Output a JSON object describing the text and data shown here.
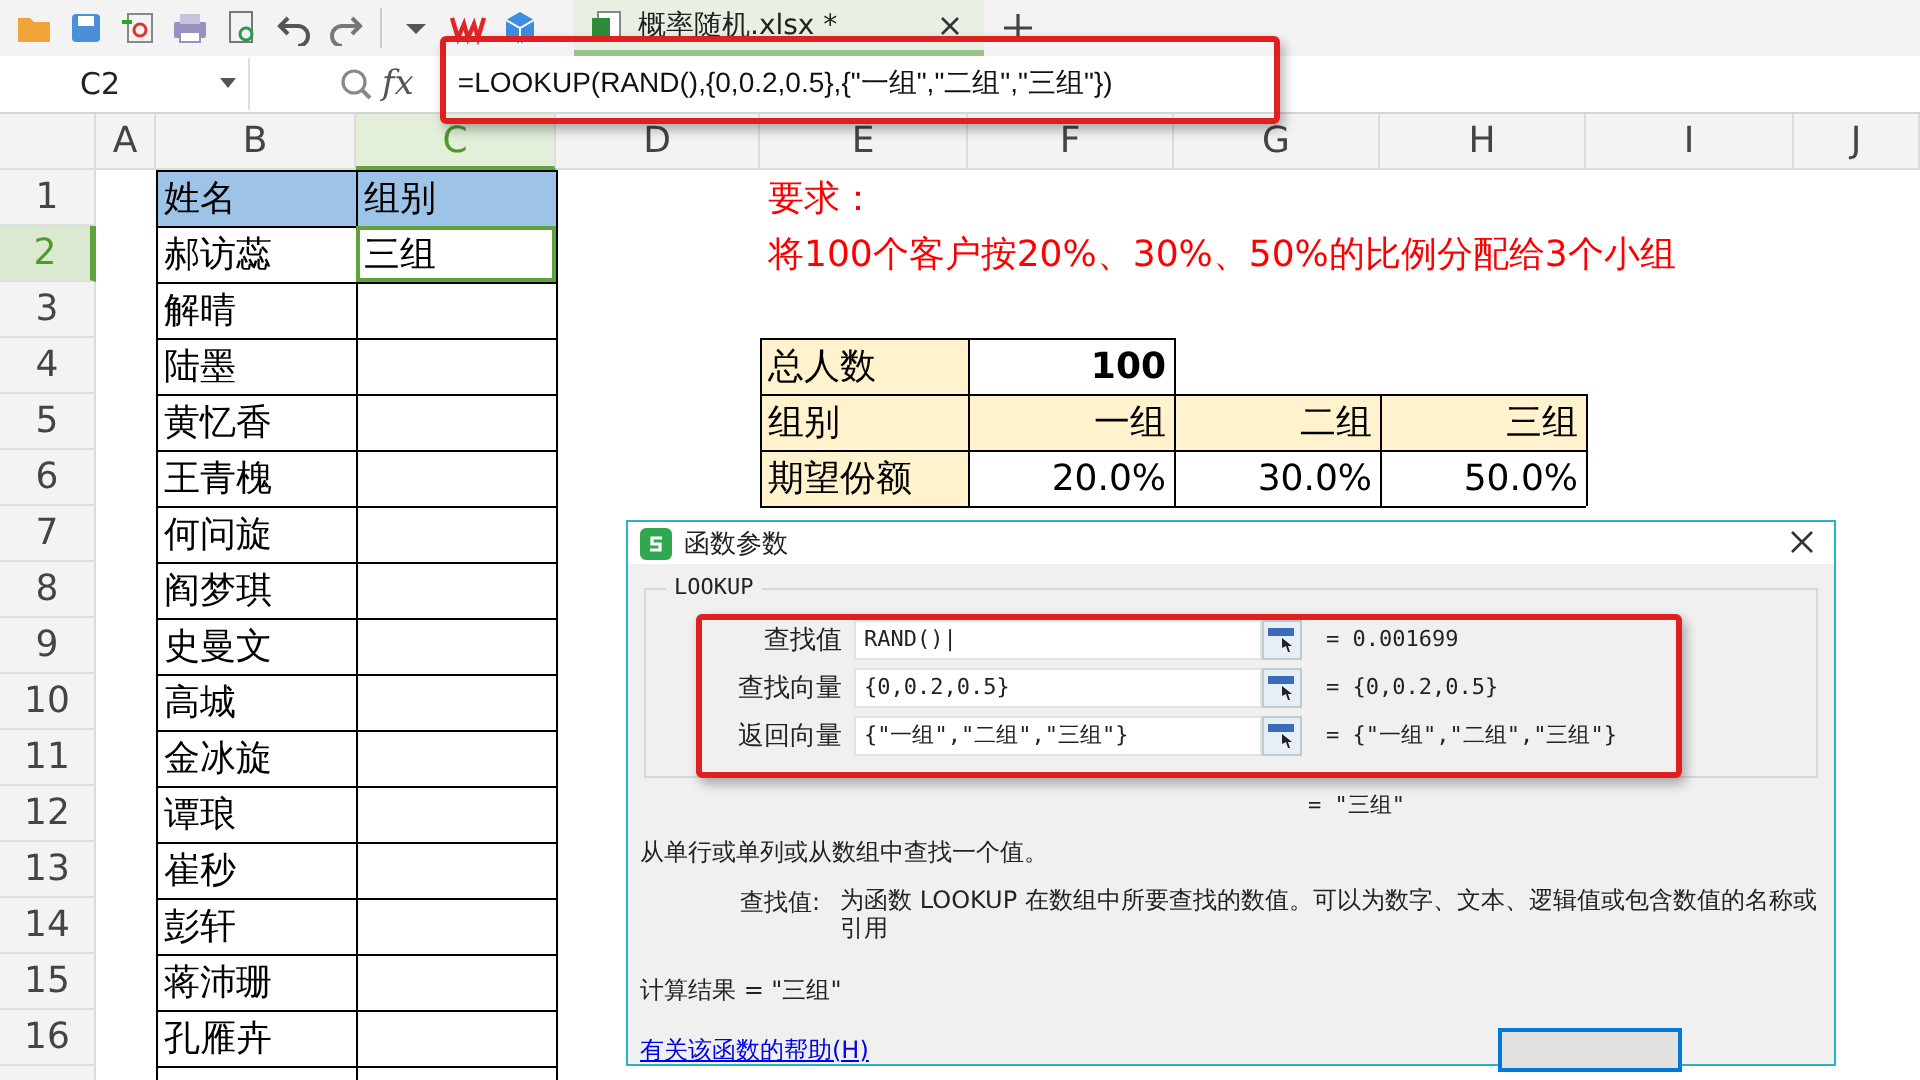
{
  "toolbar": {
    "tab": {
      "title": "概率随机.xlsx *",
      "selected": true
    }
  },
  "formula_bar": {
    "name_box": "C2",
    "fx": "fx",
    "formula": "=LOOKUP(RAND(),{0,0.2,0.5},{\"一组\",\"二组\",\"三组\"})"
  },
  "sheet": {
    "columns": [
      {
        "label": "A",
        "selected": false
      },
      {
        "label": "B",
        "selected": false
      },
      {
        "label": "C",
        "selected": true
      },
      {
        "label": "D",
        "selected": false
      },
      {
        "label": "E",
        "selected": false
      },
      {
        "label": "F",
        "selected": false
      },
      {
        "label": "G",
        "selected": false
      },
      {
        "label": "H",
        "selected": false
      },
      {
        "label": "I",
        "selected": false
      },
      {
        "label": "J",
        "selected": false
      }
    ],
    "rows": [
      {
        "number": "1",
        "selected": false,
        "cells": [
          "",
          {
            "text": "姓名",
            "kind": "header"
          },
          {
            "text": "组别",
            "kind": "header"
          },
          "",
          {
            "text": "要求：",
            "kind": "note"
          }
        ]
      },
      {
        "number": "2",
        "selected": true,
        "cells": [
          "",
          {
            "text": "郝访蕊",
            "kind": "plain"
          },
          {
            "text": "三组",
            "kind": "plain",
            "active": true
          },
          "",
          {
            "text": "将100个客户按20%、30%、50%的比例分配给3个小组",
            "kind": "note"
          }
        ]
      },
      {
        "number": "3",
        "selected": false,
        "cells": [
          "",
          {
            "text": "解晴",
            "kind": "plain"
          },
          {
            "kind": "plain"
          }
        ]
      },
      {
        "number": "4",
        "selected": false,
        "cells": [
          "",
          {
            "text": "陆墨",
            "kind": "plain"
          },
          {
            "kind": "plain"
          },
          "",
          {
            "text": "总人数",
            "kind": "label"
          },
          {
            "text": "100",
            "kind": "total"
          }
        ]
      },
      {
        "number": "5",
        "selected": false,
        "cells": [
          "",
          {
            "text": "黄忆香",
            "kind": "plain"
          },
          {
            "kind": "plain"
          },
          "",
          {
            "text": "组别",
            "kind": "label"
          },
          {
            "text": "一组",
            "kind": "label-right"
          },
          {
            "text": "二组",
            "kind": "label-right"
          },
          {
            "text": "三组",
            "kind": "label-right"
          }
        ]
      },
      {
        "number": "6",
        "selected": false,
        "cells": [
          "",
          {
            "text": "王青槐",
            "kind": "plain"
          },
          {
            "kind": "plain"
          },
          "",
          {
            "text": "期望份额",
            "kind": "label"
          },
          {
            "text": "20.0%",
            "kind": "number"
          },
          {
            "text": "30.0%",
            "kind": "number"
          },
          {
            "text": "50.0%",
            "kind": "number"
          }
        ]
      },
      {
        "number": "7",
        "selected": false,
        "cells": [
          "",
          {
            "text": "何问旋",
            "kind": "plain"
          },
          {
            "kind": "plain"
          }
        ]
      },
      {
        "number": "8",
        "selected": false,
        "cells": [
          "",
          {
            "text": "阎梦琪",
            "kind": "plain"
          },
          {
            "kind": "plain"
          }
        ]
      },
      {
        "number": "9",
        "selected": false,
        "cells": [
          "",
          {
            "text": "史曼文",
            "kind": "plain"
          },
          {
            "kind": "plain"
          }
        ]
      },
      {
        "number": "10",
        "selected": false,
        "cells": [
          "",
          {
            "text": "高城",
            "kind": "plain"
          },
          {
            "kind": "plain"
          }
        ]
      },
      {
        "number": "11",
        "selected": false,
        "cells": [
          "",
          {
            "text": "金冰旋",
            "kind": "plain"
          },
          {
            "kind": "plain"
          }
        ]
      },
      {
        "number": "12",
        "selected": false,
        "cells": [
          "",
          {
            "text": "谭琅",
            "kind": "plain"
          },
          {
            "kind": "plain"
          }
        ]
      },
      {
        "number": "13",
        "selected": false,
        "cells": [
          "",
          {
            "text": "崔秒",
            "kind": "plain"
          },
          {
            "kind": "plain"
          }
        ]
      },
      {
        "number": "14",
        "selected": false,
        "cells": [
          "",
          {
            "text": "彭轩",
            "kind": "plain"
          },
          {
            "kind": "plain"
          }
        ]
      },
      {
        "number": "15",
        "selected": false,
        "cells": [
          "",
          {
            "text": "蒋沛珊",
            "kind": "plain"
          },
          {
            "kind": "plain"
          }
        ]
      },
      {
        "number": "16",
        "selected": false,
        "cells": [
          "",
          {
            "text": "孔雁卉",
            "kind": "plain"
          },
          {
            "kind": "plain"
          }
        ]
      },
      {
        "selected": false,
        "cells": [
          "",
          {
            "kind": "plain"
          },
          {
            "kind": "plain"
          }
        ]
      }
    ]
  },
  "dialog": {
    "title": "函数参数",
    "function": "LOOKUP",
    "arguments": [
      {
        "label": "查找值",
        "value": "RAND()|",
        "result": "= 0.001699"
      },
      {
        "label": "查找向量",
        "value": "{0,0.2,0.5}",
        "result": "= {0,0.2,0.5}"
      },
      {
        "label": "返回向量",
        "value": "{\"一组\",\"二组\",\"三组\"}",
        "result": "= {\"一组\",\"二组\",\"三组\"}"
      }
    ],
    "overall_result": "= \"三组\"",
    "description": "从单行或单列或从数组中查找一个值。",
    "arg_help_label": "查找值:",
    "arg_help": "为函数 LOOKUP 在数组中所要查找的数值。可以为数字、文本、逻辑值或包含数值的名称或引用",
    "calc_result": "计算结果 = \"三组\"",
    "help_link": "有关该函数的帮助(H)"
  }
}
